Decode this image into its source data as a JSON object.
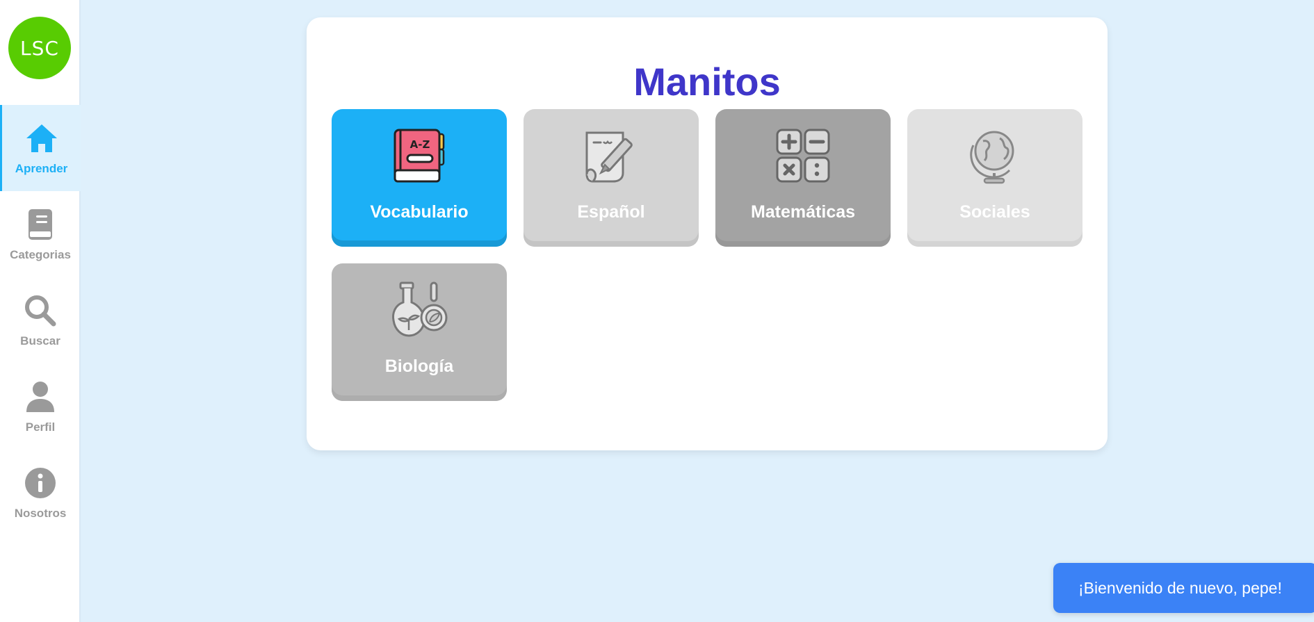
{
  "app": {
    "logo_text": "LSC",
    "title": "Manitos"
  },
  "sidebar": {
    "items": [
      {
        "label": "Aprender",
        "icon": "home-icon",
        "active": true
      },
      {
        "label": "Categorias",
        "icon": "book-icon",
        "active": false
      },
      {
        "label": "Buscar",
        "icon": "search-icon",
        "active": false
      },
      {
        "label": "Perfil",
        "icon": "user-icon",
        "active": false
      },
      {
        "label": "Nosotros",
        "icon": "info-icon",
        "active": false
      }
    ]
  },
  "subjects": [
    {
      "label": "Vocabulario",
      "icon": "a-z-book-icon",
      "color": "#1cb0f6",
      "active": true
    },
    {
      "label": "Español",
      "icon": "notepad-pencil-icon",
      "color": "#d3d3d3"
    },
    {
      "label": "Matemáticas",
      "icon": "calculator-icon",
      "color": "#a3a3a3"
    },
    {
      "label": "Sociales",
      "icon": "globe-icon",
      "color": "#e1e1e1"
    },
    {
      "label": "Biología",
      "icon": "flask-leaf-icon",
      "color": "#b8b8b8"
    }
  ],
  "toast": {
    "message": "¡Bienvenido de nuevo, pepe!"
  },
  "colors": {
    "accent": "#1cb0f6",
    "title": "#3f36c9",
    "logo": "#58cc02",
    "toast": "#3b82f6",
    "background": "#dff0fc"
  }
}
